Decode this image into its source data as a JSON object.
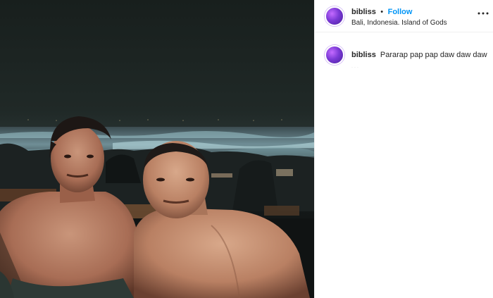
{
  "post": {
    "username": "bibliss",
    "separator": "•",
    "follow_label": "Follow",
    "location": "Bali, Indonesia. Island of Gods",
    "more_icon": "more-horizontal-icon"
  },
  "caption": {
    "username": "bibliss",
    "text": "Pararap pap pap daw daw daw"
  },
  "photo": {
    "alt": "two men at a night beach"
  },
  "colors": {
    "follow": "#0095f6",
    "text": "#262626",
    "divider": "#efefef"
  }
}
